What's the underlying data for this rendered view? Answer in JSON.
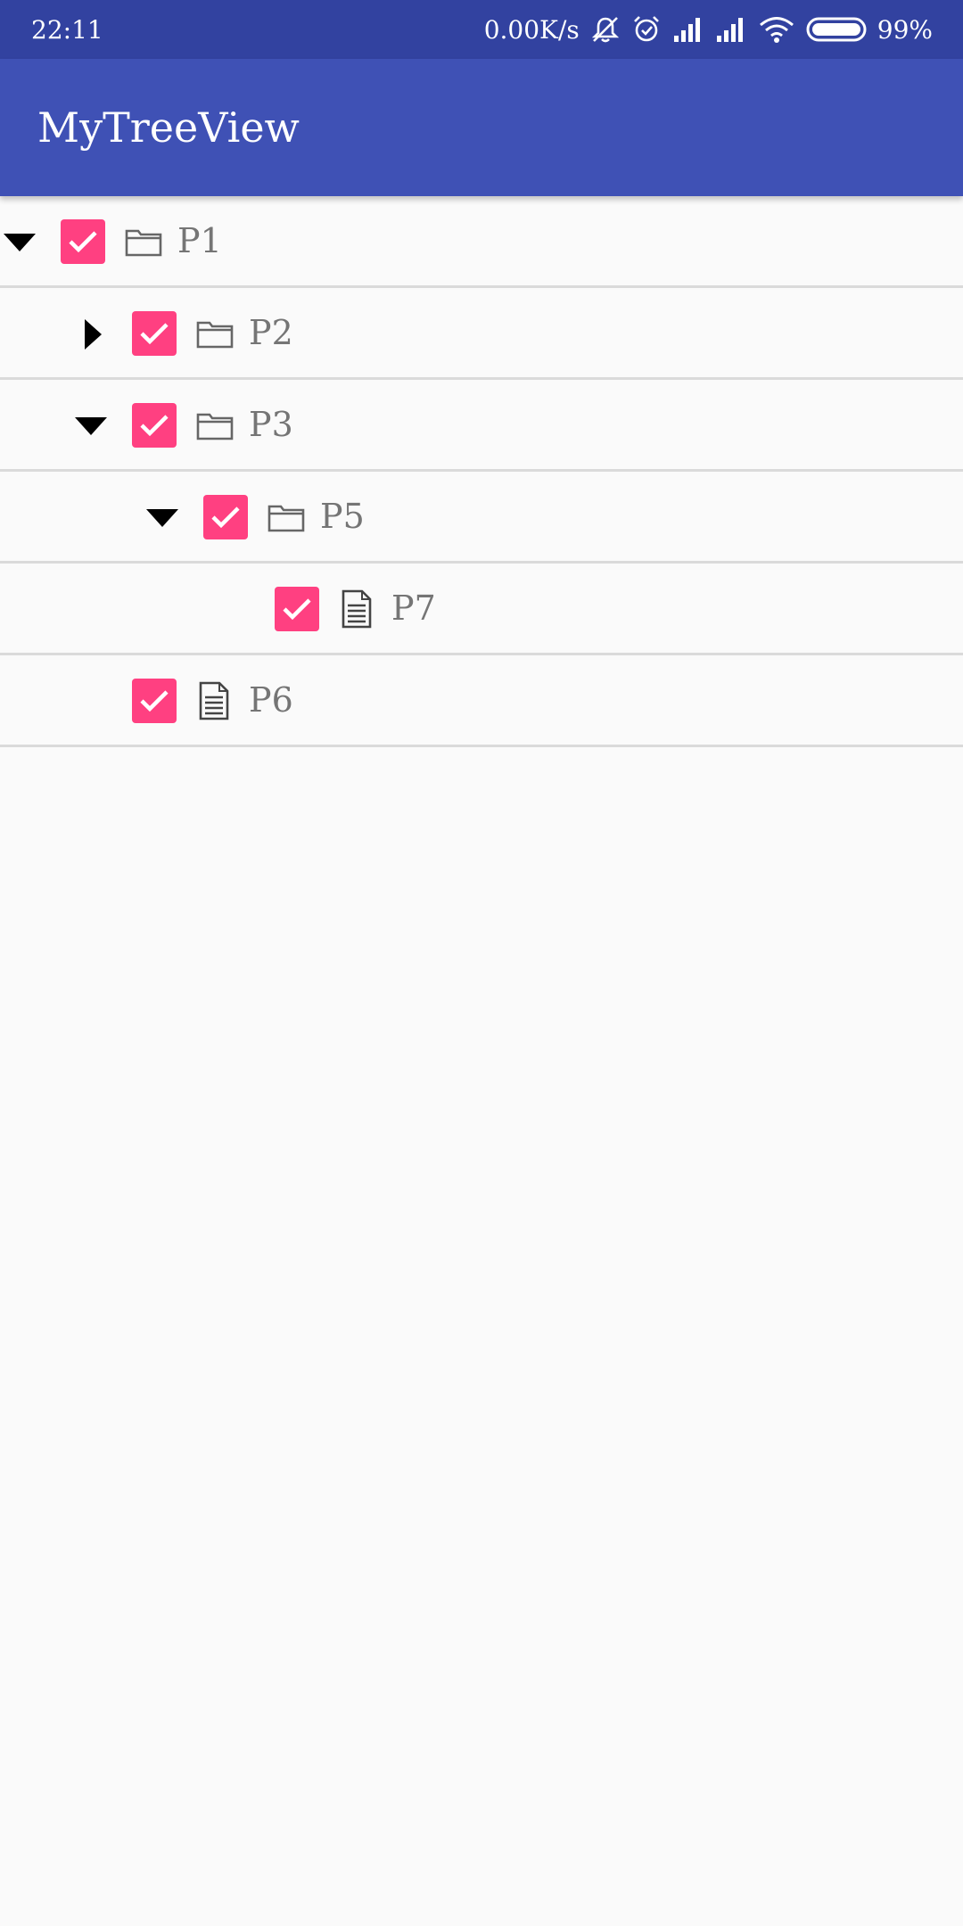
{
  "status_bar": {
    "time": "22:11",
    "net_speed": "0.00K/s",
    "battery": "99%"
  },
  "app_bar": {
    "title": "MyTreeView"
  },
  "colors": {
    "status_bar": "#3242a0",
    "app_bar": "#3f51b5",
    "checkbox": "#ff4081",
    "label": "#757575",
    "divider": "#dadada"
  },
  "tree": {
    "nodes": [
      {
        "label": "P1",
        "level": 0,
        "type": "folder",
        "expanded": true,
        "checked": true,
        "toggle_icon": "caret-down-icon",
        "node_icon": "folder-icon"
      },
      {
        "label": "P2",
        "level": 1,
        "type": "folder",
        "expanded": false,
        "checked": true,
        "toggle_icon": "caret-right-icon",
        "node_icon": "folder-icon"
      },
      {
        "label": "P3",
        "level": 1,
        "type": "folder",
        "expanded": true,
        "checked": true,
        "toggle_icon": "caret-down-icon",
        "node_icon": "folder-icon"
      },
      {
        "label": "P5",
        "level": 2,
        "type": "folder",
        "expanded": true,
        "checked": true,
        "toggle_icon": "caret-down-icon",
        "node_icon": "folder-icon"
      },
      {
        "label": "P7",
        "level": 3,
        "type": "file",
        "checked": true,
        "node_icon": "document-icon"
      },
      {
        "label": "P6",
        "level": 1,
        "type": "file",
        "checked": true,
        "node_icon": "document-icon"
      }
    ]
  }
}
